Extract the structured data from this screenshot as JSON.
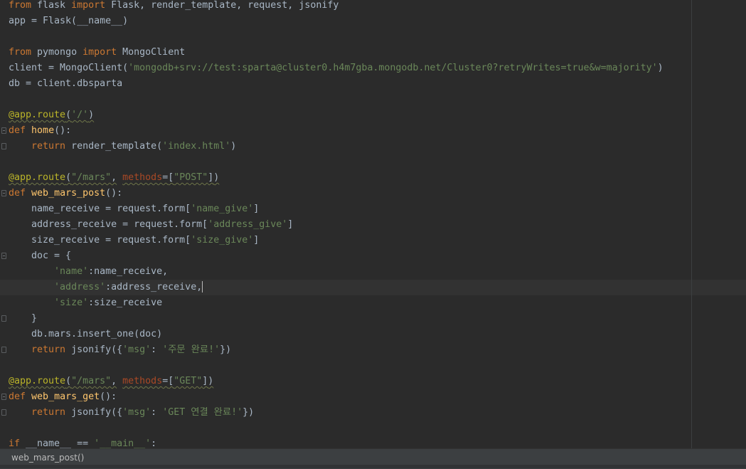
{
  "editor": {
    "language": "python",
    "colors": {
      "background": "#2b2b2b",
      "keyword": "#cc7832",
      "string": "#6a8759",
      "decorator": "#bbb529",
      "function": "#ffc66d",
      "parameter": "#aa4926",
      "text": "#a9b7c6"
    },
    "lines": [
      "from flask import Flask, render_template, request, jsonify",
      "app = Flask(__name__)",
      "",
      "from pymongo import MongoClient",
      "client = MongoClient('mongodb+srv://test:sparta@cluster0.h4m7gba.mongodb.net/Cluster0?retryWrites=true&w=majority')",
      "db = client.dbsparta",
      "",
      "@app.route('/')",
      "def home():",
      "    return render_template('index.html')",
      "",
      "@app.route(\"/mars\", methods=[\"POST\"])",
      "def web_mars_post():",
      "    name_receive = request.form['name_give']",
      "    address_receive = request.form['address_give']",
      "    size_receive = request.form['size_give']",
      "    doc = {",
      "        'name':name_receive,",
      "        'address':address_receive,",
      "        'size':size_receive",
      "    }",
      "    db.mars.insert_one(doc)",
      "    return jsonify({'msg': '주문 완료!'})",
      "",
      "@app.route(\"/mars\", methods=[\"GET\"])",
      "def web_mars_get():",
      "    return jsonify({'msg': 'GET 연결 완료!'})",
      "",
      "if __name__ == '__main__':"
    ]
  },
  "statusbar": {
    "breadcrumb": "web_mars_post()"
  }
}
